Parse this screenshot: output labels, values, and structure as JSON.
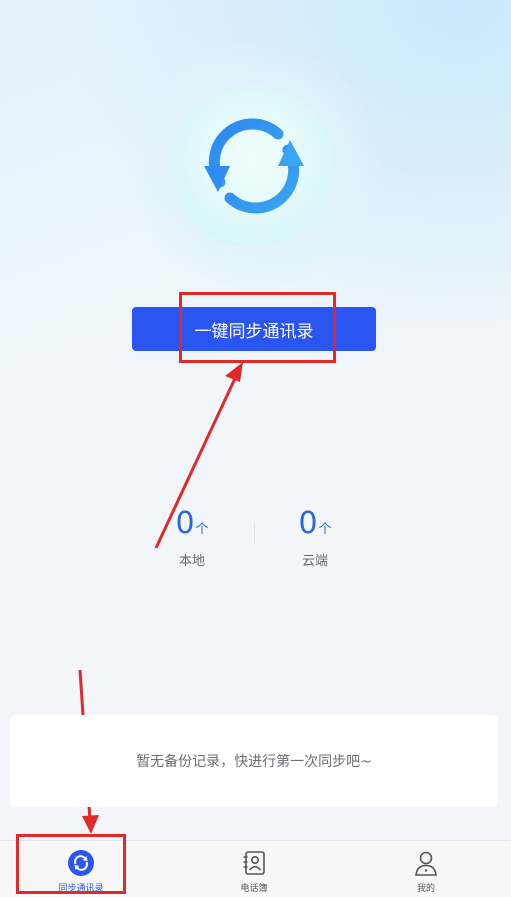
{
  "main": {
    "sync_button_label": "一键同步通讯录"
  },
  "stats": {
    "local": {
      "count": "0",
      "unit": "个",
      "label": "本地"
    },
    "cloud": {
      "count": "0",
      "unit": "个",
      "label": "云端"
    }
  },
  "backup": {
    "empty_message": "暂无备份记录，快进行第一次同步吧~"
  },
  "tabbar": {
    "items": [
      {
        "label": "同步通讯录",
        "icon": "sync-icon",
        "active": true
      },
      {
        "label": "电话簿",
        "icon": "contacts-book-icon",
        "active": false
      },
      {
        "label": "我的",
        "icon": "person-icon",
        "active": false
      }
    ]
  },
  "colors": {
    "primary": "#2a55f0",
    "stat_blue": "#2a66e0",
    "annotation_red": "#e02a2a"
  }
}
